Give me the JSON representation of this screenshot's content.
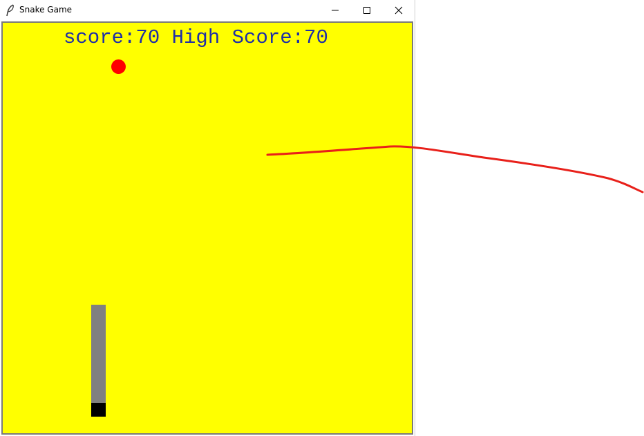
{
  "window": {
    "title": "Snake Game",
    "controls": [
      "minimize",
      "maximize",
      "close"
    ]
  },
  "game": {
    "score_text": "score:70 High Score:70",
    "score": 70,
    "high_score": 70,
    "colors": {
      "board": "#ffff00",
      "text": "#1f2fa6",
      "food": "#ff0000",
      "snake_body": "#808080",
      "snake_head": "#000000"
    }
  },
  "icons": {
    "app": "feather-icon",
    "minimize": "minimize-icon",
    "maximize": "maximize-icon",
    "close": "close-icon"
  }
}
